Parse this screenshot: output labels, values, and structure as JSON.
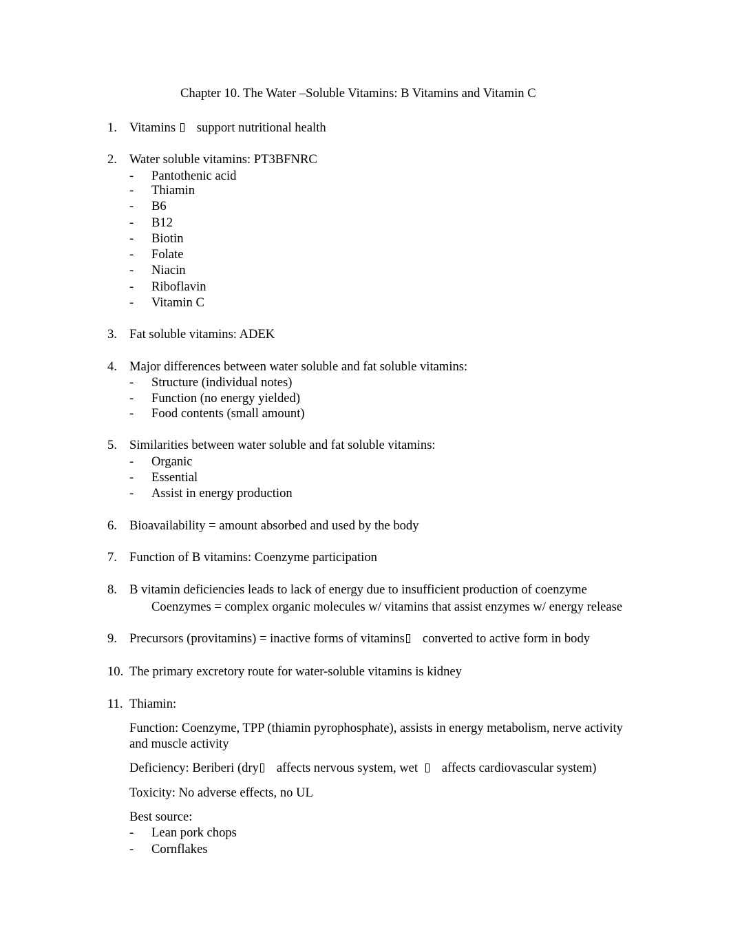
{
  "title": "Chapter 10. The Water –Soluble Vitamins: B Vitamins and Vitamin C",
  "items": [
    {
      "num": "1.",
      "before": "Vitamins",
      "arrow": "missing-glyph-arrow",
      "after": "support nutritional health"
    },
    {
      "num": "2.",
      "text": "Water soluble vitamins: PT3BFNRC",
      "bullets": [
        "Pantothenic acid",
        "Thiamin",
        "B6",
        "B12",
        "Biotin",
        "Folate",
        "Niacin",
        "Riboflavin",
        "Vitamin C"
      ]
    },
    {
      "num": "3.",
      "text": "Fat soluble vitamins: ADEK"
    },
    {
      "num": "4.",
      "text": "Major differences between water soluble and fat soluble vitamins:",
      "bullets": [
        "Structure (individual notes)",
        "Function (no energy yielded)",
        "Food contents (small amount)"
      ]
    },
    {
      "num": "5.",
      "text": "Similarities between water soluble and fat soluble vitamins:",
      "bullets": [
        "Organic",
        "Essential",
        "Assist in energy production"
      ]
    },
    {
      "num": "6.",
      "text": "Bioavailability = amount absorbed and used by the body"
    },
    {
      "num": "7.",
      "text": "Function of B vitamins: Coenzyme participation"
    },
    {
      "num": "8.",
      "text": "B vitamin deficiencies leads to lack of energy due to insufficient production of coenzyme",
      "subline": "Coenzymes = complex organic molecules w/ vitamins that assist enzymes w/ energy release"
    },
    {
      "num": "9.",
      "before": "Precursors (provitamins) = inactive forms of vitamins",
      "after": "converted to active form in body"
    },
    {
      "num": "10.",
      "text": "The primary excretory route for water-soluble vitamins is kidney"
    },
    {
      "num": "11.",
      "text": "Thiamin:",
      "function_line1": "Function: Coenzyme, TPP (thiamin pyrophosphate), assists in energy metabolism, nerve activity",
      "function_line2": "and muscle activity",
      "deficiency_a": "Deficiency: Beriberi (dry",
      "deficiency_b": "affects nervous system, wet",
      "deficiency_c": "affects cardiovascular system)",
      "toxicity": "Toxicity: No adverse effects, no UL",
      "best_source_label": "Best source:",
      "bullets": [
        "Lean pork chops",
        "Cornflakes"
      ]
    }
  ],
  "dash": "-"
}
